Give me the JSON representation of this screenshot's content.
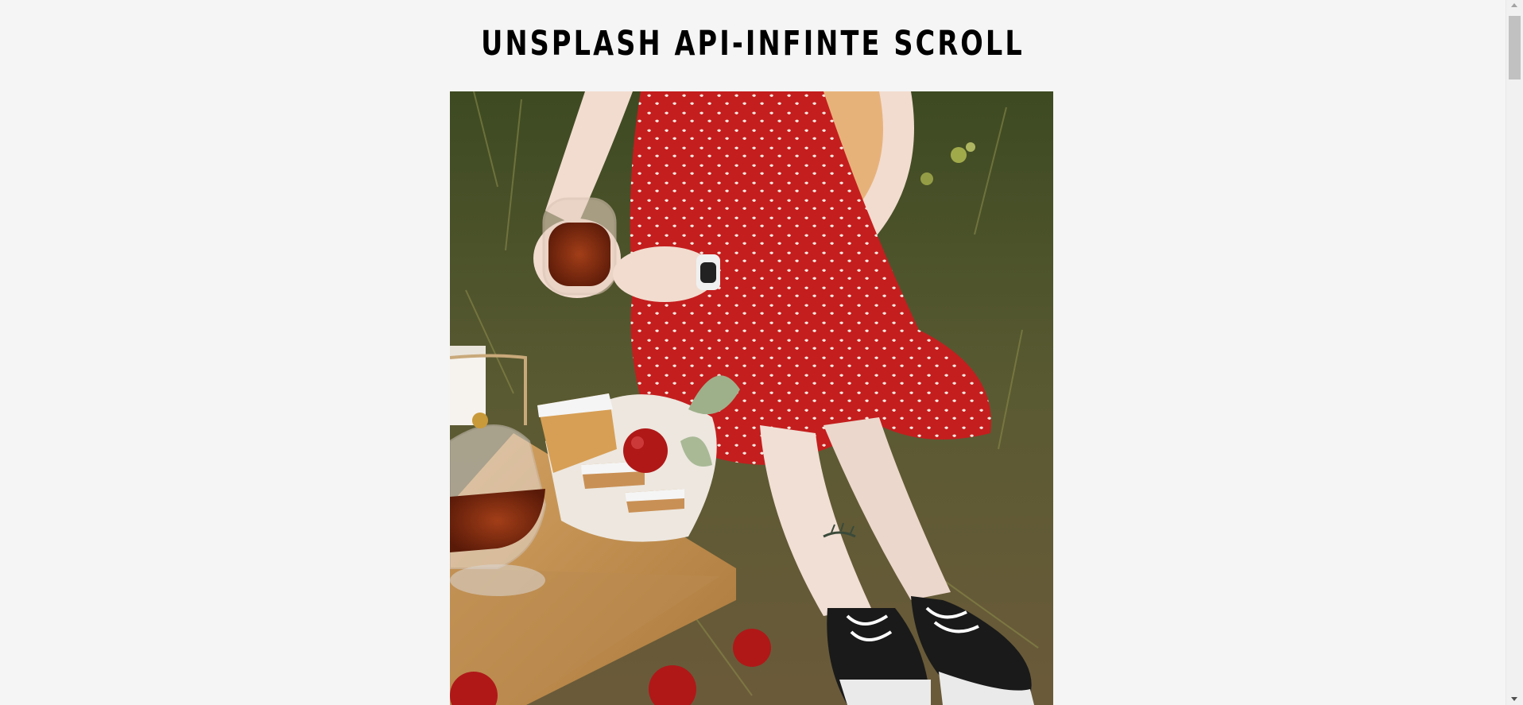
{
  "page": {
    "title": "UNSPLASH API-INFINTE SCROLL"
  },
  "gallery": {
    "images": [
      {
        "subject": "picnic-photo",
        "colors": {
          "dress": "#c41e1e",
          "grass": "#4a5a2a",
          "wood": "#b8894a",
          "tea": "#7a2a10",
          "skin": "#f2dccf",
          "hair": "#e7b27a",
          "shoes": "#1a1a1a",
          "apple": "#b01818"
        }
      }
    ]
  },
  "theme": {
    "background": "#f5f5f5",
    "title_color": "#000000",
    "scrollbar_thumb": "#c1c1c1"
  }
}
